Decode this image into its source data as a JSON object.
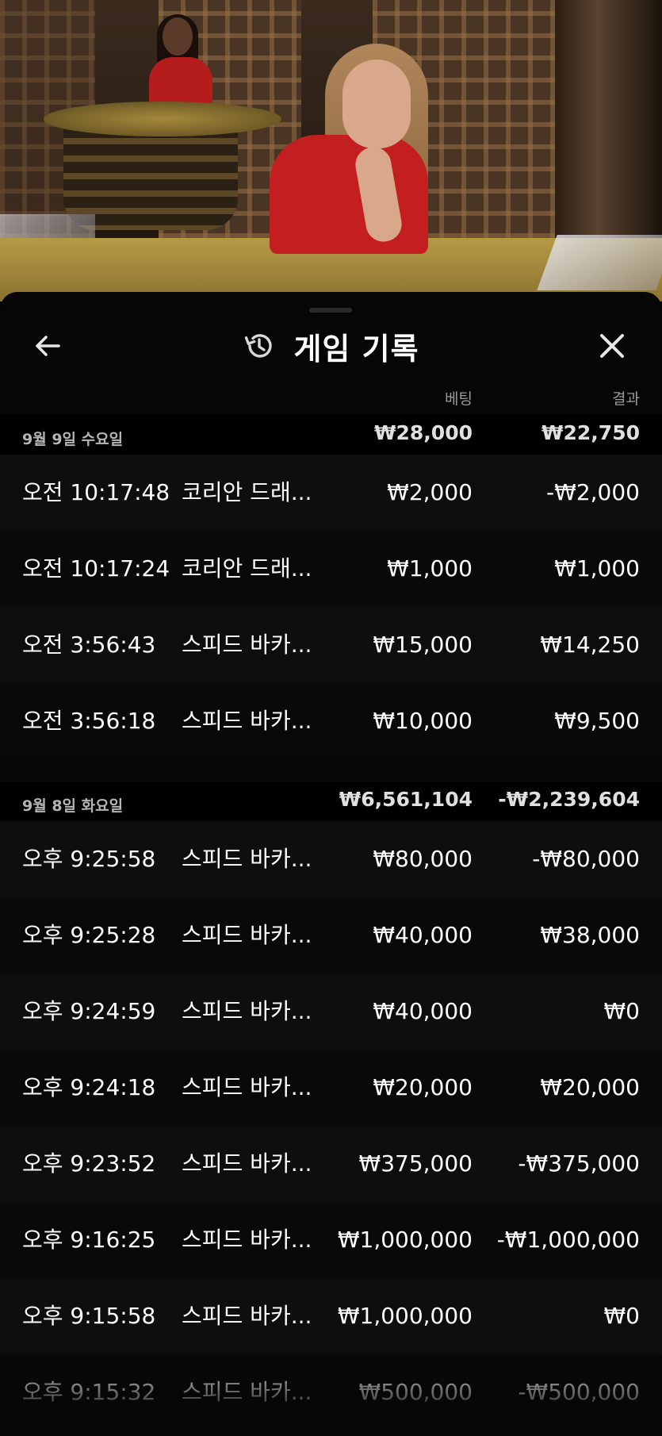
{
  "header": {
    "title": "게임 기록"
  },
  "columns": {
    "bet": "베팅",
    "result": "결과"
  },
  "days": [
    {
      "label": "9월 9일 수요일",
      "total_bet": "₩28,000",
      "total_result": "₩22,750",
      "rows": [
        {
          "time": "오전 10:17:48",
          "game": "코리안 드래...",
          "bet": "₩2,000",
          "result": "-₩2,000"
        },
        {
          "time": "오전 10:17:24",
          "game": "코리안 드래...",
          "bet": "₩1,000",
          "result": "₩1,000"
        },
        {
          "time": "오전 3:56:43",
          "game": "스피드 바카...",
          "bet": "₩15,000",
          "result": "₩14,250"
        },
        {
          "time": "오전 3:56:18",
          "game": "스피드 바카...",
          "bet": "₩10,000",
          "result": "₩9,500"
        }
      ]
    },
    {
      "label": "9월 8일 화요일",
      "total_bet": "₩6,561,104",
      "total_result": "-₩2,239,604",
      "rows": [
        {
          "time": "오후 9:25:58",
          "game": "스피드 바카...",
          "bet": "₩80,000",
          "result": "-₩80,000"
        },
        {
          "time": "오후 9:25:28",
          "game": "스피드 바카...",
          "bet": "₩40,000",
          "result": "₩38,000"
        },
        {
          "time": "오후 9:24:59",
          "game": "스피드 바카...",
          "bet": "₩40,000",
          "result": "₩0"
        },
        {
          "time": "오후 9:24:18",
          "game": "스피드 바카...",
          "bet": "₩20,000",
          "result": "₩20,000"
        },
        {
          "time": "오후 9:23:52",
          "game": "스피드 바카...",
          "bet": "₩375,000",
          "result": "-₩375,000"
        },
        {
          "time": "오후 9:16:25",
          "game": "스피드 바카...",
          "bet": "₩1,000,000",
          "result": "-₩1,000,000"
        },
        {
          "time": "오후 9:15:58",
          "game": "스피드 바카...",
          "bet": "₩1,000,000",
          "result": "₩0"
        },
        {
          "time": "오후 9:15:32",
          "game": "스피드 바카...",
          "bet": "₩500,000",
          "result": "-₩500,000"
        }
      ]
    }
  ],
  "icons": {
    "back": "arrow-left-icon",
    "history": "history-icon",
    "close": "close-icon"
  }
}
